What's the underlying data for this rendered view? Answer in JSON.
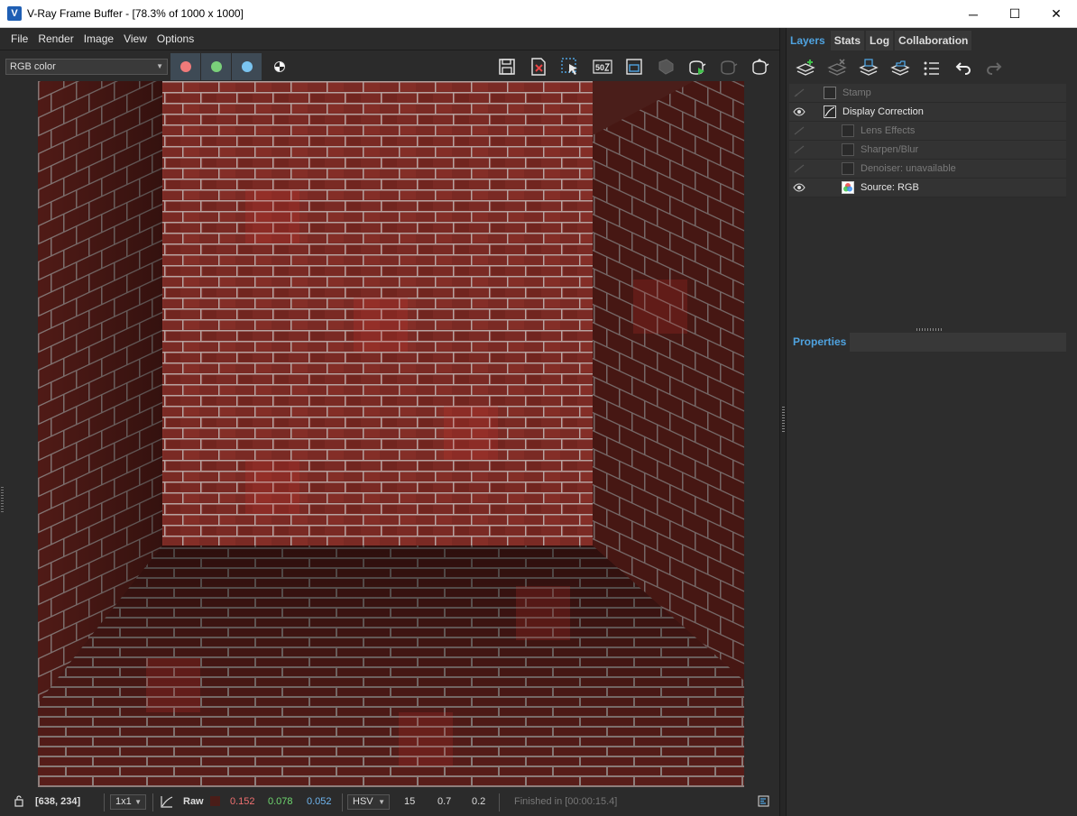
{
  "window": {
    "title": "V-Ray Frame Buffer - [78.3% of 1000 x 1000]",
    "app_icon": "vray-icon",
    "minimize": "─",
    "maximize": "☐",
    "close": "✕"
  },
  "menu": [
    "File",
    "Render",
    "Image",
    "View",
    "Options"
  ],
  "toolbar": {
    "channel": "RGB color",
    "channel_buttons": [
      {
        "name": "red-channel-button",
        "color": "#f07a7a"
      },
      {
        "name": "green-channel-button",
        "color": "#7ad07a"
      },
      {
        "name": "blue-channel-button",
        "color": "#7ac4f0"
      },
      {
        "name": "alpha-channel-button",
        "color": "#ffffff"
      }
    ],
    "icons": [
      "save-image-icon",
      "clear-image-icon",
      "track-mouse-icon",
      "bucket-size-icon",
      "region-render-icon",
      "stop-render-icon",
      "interactive-render-icon",
      "render-last-icon",
      "render-icon"
    ]
  },
  "status": {
    "coords": "[638, 234]",
    "ratio": "1x1",
    "raw_label": "Raw",
    "r": "0.152",
    "g": "0.078",
    "b": "0.052",
    "r_color": "#f07070",
    "g_color": "#6fd86f",
    "b_color": "#6fb6f0",
    "mode": "HSV",
    "h": "15",
    "s": "0.7",
    "v": "0.2",
    "finished": "Finished in [00:00:15.4]"
  },
  "panel": {
    "tabs": [
      "Layers",
      "Stats",
      "Log",
      "Collaboration"
    ],
    "active_tab": "Layers",
    "layers": [
      {
        "label": "Stamp",
        "visible": false,
        "indent": 0
      },
      {
        "label": "Display Correction",
        "visible": true,
        "indent": 0
      },
      {
        "label": "Lens Effects",
        "visible": false,
        "indent": 1
      },
      {
        "label": "Sharpen/Blur",
        "visible": false,
        "indent": 1
      },
      {
        "label": "Denoiser: unavailable",
        "visible": false,
        "indent": 1
      },
      {
        "label": "Source: RGB",
        "visible": true,
        "indent": 1
      }
    ],
    "properties_title": "Properties",
    "accent": "#4fa3e0"
  }
}
